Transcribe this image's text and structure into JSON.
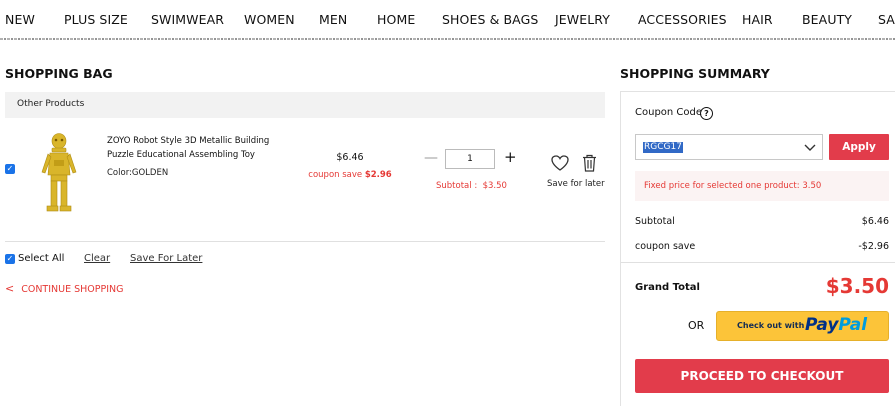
{
  "nav": {
    "items": [
      "NEW",
      "PLUS SIZE",
      "SWIMWEAR",
      "WOMEN",
      "MEN",
      "HOME",
      "SHOES & BAGS",
      "JEWELRY",
      "ACCESSORIES",
      "HAIR",
      "BEAUTY",
      "SAL"
    ]
  },
  "bag": {
    "title": "SHOPPING BAG",
    "group_label": "Other Products",
    "product": {
      "name": "ZOYO Robot Style 3D Metallic Building Puzzle Educational Assembling Toy",
      "color": "Color:GOLDEN",
      "price": "$6.46",
      "coupon_save_label": "coupon save",
      "coupon_save_value": "$2.96",
      "quantity": "1",
      "subtotal": "Subtotal :  $3.50",
      "save_for_later": "Save for later",
      "checked": true
    },
    "select_all_label": "Select All",
    "clear_label": "Clear",
    "save_for_later_link": "Save For Later",
    "continue_label": "CONTINUE SHOPPING"
  },
  "summary": {
    "title": "SHOPPING SUMMARY",
    "coupon_code_label": "Coupon Code",
    "coupon_selected": "RGCG17",
    "apply_label": "Apply",
    "coupon_note": "Fixed price for selected one product: 3.50",
    "subtotal_label": "Subtotal",
    "subtotal_value": "$6.46",
    "coupon_save_label": "coupon save",
    "coupon_save_value": "-$2.96",
    "grand_total_label": "Grand Total",
    "grand_total_value": "$3.50",
    "or_label": "OR",
    "paypal_small": "Check out with",
    "paypal_brand_1": "Pay",
    "paypal_brand_2": "Pal",
    "checkout_label": "PROCEED TO CHECKOUT"
  },
  "colors": {
    "accent_red": "#e23c4b",
    "text_red": "#e53935",
    "paypal_yellow": "#fcc439",
    "checkbox_blue": "#1a73e8"
  }
}
